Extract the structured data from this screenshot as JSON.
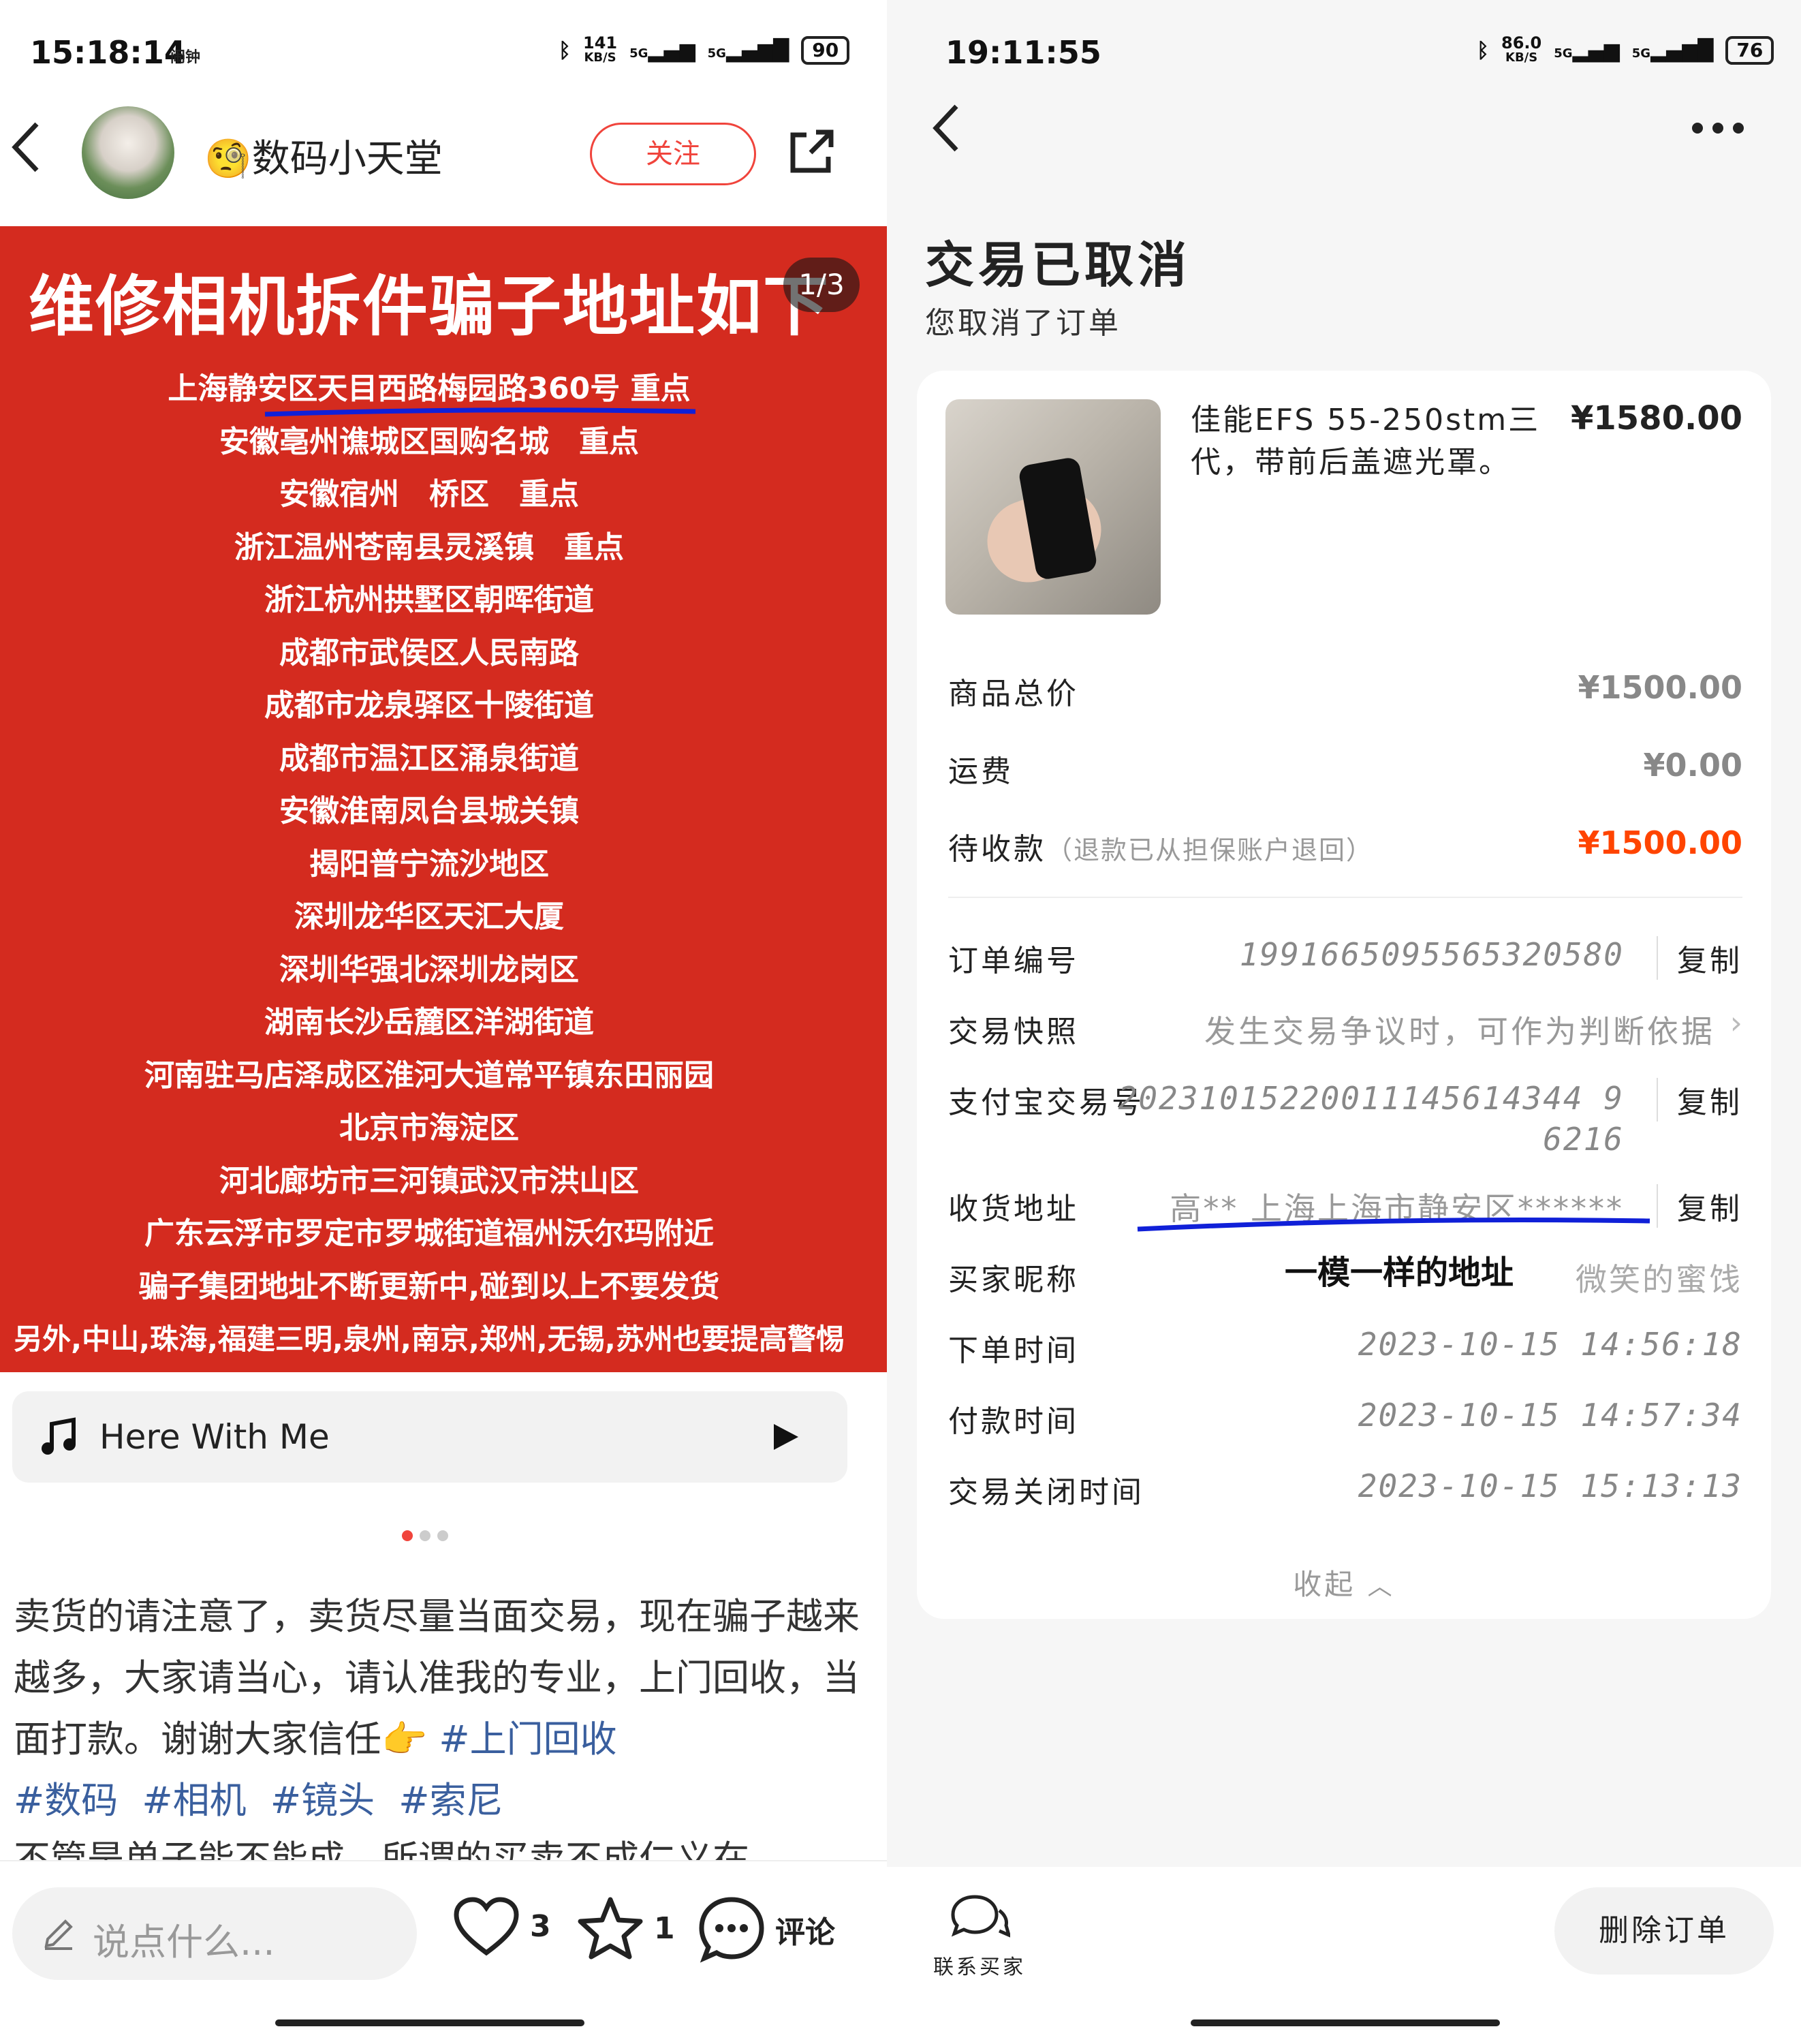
{
  "left": {
    "status": {
      "time": "15:18:14",
      "alarm": "闹钟",
      "net_speed": "141",
      "net_unit": "KB/S",
      "sig1": "5G",
      "sig2": "5G",
      "battery": "90"
    },
    "header": {
      "username": "数码小天堂",
      "follow_label": "关注"
    },
    "banner": {
      "title": "维修相机拆件骗子地址如下",
      "pager": "1/3",
      "lines": [
        "上海静安区天目西路梅园路360号 重点",
        "安徽亳州谯城区国购名城　重点",
        "安徽宿州　桥区　重点",
        "浙江温州苍南县灵溪镇　重点",
        "浙江杭州拱墅区朝晖街道",
        "成都市武侯区人民南路",
        "成都市龙泉驿区十陵街道",
        "成都市温江区涌泉街道",
        "安徽淮南凤台县城关镇",
        "揭阳普宁流沙地区",
        "深圳龙华区天汇大厦",
        "深圳华强北深圳龙岗区",
        "湖南长沙岳麓区洋湖街道",
        "河南驻马店泽成区淮河大道常平镇东田丽园",
        "北京市海淀区",
        "河北廊坊市三河镇武汉市洪山区",
        "广东云浮市罗定市罗城街道福州沃尔玛附近",
        "骗子集团地址不断更新中,碰到以上不要发货",
        "另外,中山,珠海,福建三明,泉州,南京,郑州,无锡,苏州也要提高警惕"
      ]
    },
    "music": {
      "title": "Here With Me"
    },
    "post": {
      "text": "卖货的请注意了，卖货尽量当面交易，现在骗子越来越多，大家请当心，请认准我的专业，上门回收，当面打款。谢谢大家信任👉",
      "tags": [
        "#上门回收",
        "#数码",
        "#相机",
        "#镜头",
        "#索尼"
      ],
      "cut_line": "不管是单子能不能成，所谓的买卖不成仁义在"
    },
    "bottom": {
      "placeholder": "说点什么...",
      "likes": "3",
      "stars": "1",
      "comment_label": "评论"
    }
  },
  "right": {
    "status": {
      "time": "19:11:55",
      "net_speed": "86.0",
      "net_unit": "KB/S",
      "sig1": "5G",
      "sig2": "5G",
      "battery": "76"
    },
    "title": "交易已取消",
    "subtitle": "您取消了订单",
    "product": {
      "name": "佳能EFS 55-250stm三代，带前后盖遮光罩。",
      "price": "¥1580.00"
    },
    "summary": [
      {
        "label": "商品总价",
        "value": "¥1500.00"
      },
      {
        "label": "运费",
        "value": "¥0.00"
      }
    ],
    "pending": {
      "label": "待收款",
      "note": "（退款已从担保账户退回）",
      "value": "¥1500.00"
    },
    "details": {
      "order_no": {
        "label": "订单编号",
        "value": "1991665095565320580",
        "copy": "复制"
      },
      "snapshot": {
        "label": "交易快照",
        "value": "发生交易争议时，可作为判断依据"
      },
      "alipay": {
        "label": "支付宝交易号",
        "value_line1": "20231015220011145614344 9",
        "value_line2": "6216",
        "copy": "复制"
      },
      "address": {
        "label": "收货地址",
        "value": "高** 上海上海市静安区******",
        "copy": "复制"
      },
      "buyer": {
        "label": "买家昵称",
        "value": "微笑的蜜饯"
      },
      "order_time": {
        "label": "下单时间",
        "value": "2023-10-15 14:56:18"
      },
      "pay_time": {
        "label": "付款时间",
        "value": "2023-10-15 14:57:34"
      },
      "close_time": {
        "label": "交易关闭时间",
        "value": "2023-10-15 15:13:13"
      }
    },
    "annotation": "一模一样的地址",
    "collapse_label": "收起",
    "bottom": {
      "contact_label": "联系买家",
      "delete_label": "删除订单"
    }
  },
  "colors": {
    "banner_red": "#d42b1f",
    "accent_red": "#f0443c",
    "price_red": "#ff4400",
    "underline_blue": "#1020d8",
    "tag_blue": "#3a5f9e"
  }
}
